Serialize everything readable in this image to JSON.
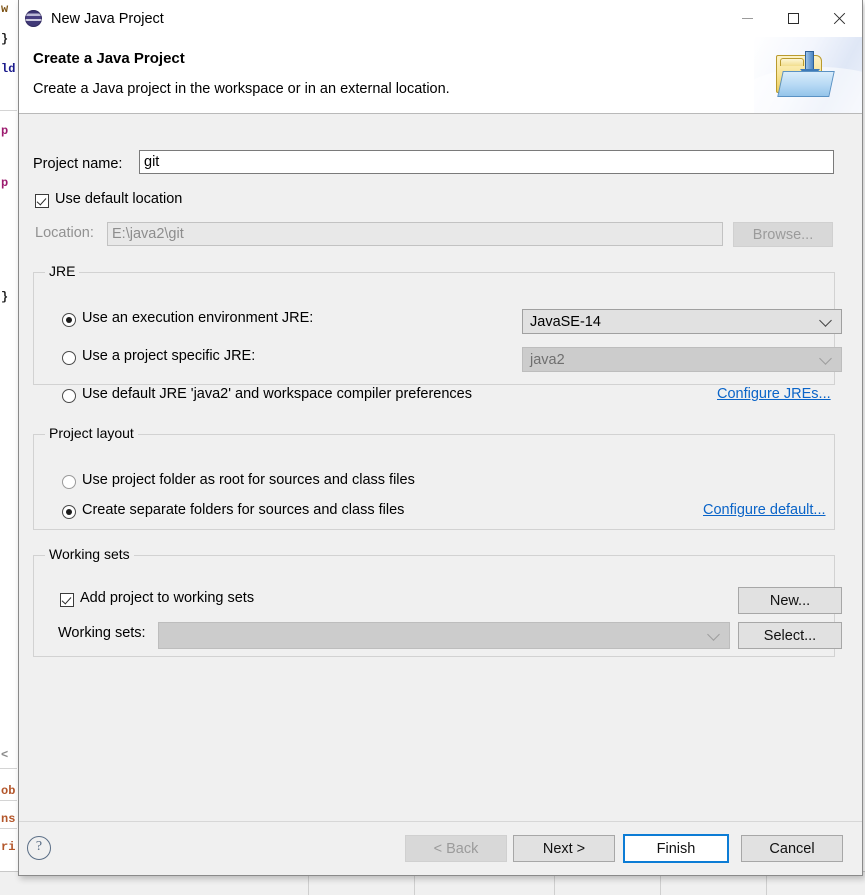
{
  "window": {
    "title": "New Java Project",
    "app_icon": "eclipse-sphere-icon",
    "minimize_label": "Minimize",
    "maximize_label": "Maximize",
    "close_label": "Close"
  },
  "header": {
    "title": "Create a Java Project",
    "description": "Create a Java project in the workspace or in an external location.",
    "banner_icon": "new-java-project-folder-icon"
  },
  "project": {
    "name_label": "Project name:",
    "name_value": "git",
    "name_placeholder": "",
    "use_default_location_label": "Use default location",
    "use_default_location_checked": true,
    "location_label": "Location:",
    "location_value": "E:\\java2\\git",
    "browse_label": "Browse...",
    "browse_enabled": false
  },
  "jre": {
    "group_title": "JRE",
    "option_execution_env": "Use an execution environment JRE:",
    "option_project_specific": "Use a project specific JRE:",
    "option_default_jre": "Use default JRE 'java2' and workspace compiler preferences",
    "selected": "execution_env",
    "execution_env_value": "JavaSE-14",
    "project_specific_value": "java2",
    "configure_link": "Configure JREs..."
  },
  "project_layout": {
    "group_title": "Project layout",
    "option_project_folder_root": "Use project folder as root for sources and class files",
    "option_separate_folders": "Create separate folders for sources and class files",
    "selected": "separate_folders",
    "configure_link": "Configure default..."
  },
  "working_sets": {
    "group_title": "Working sets",
    "add_checkbox_label": "Add project to working sets",
    "add_checkbox_checked": true,
    "new_button": "New...",
    "working_sets_label": "Working sets:",
    "working_sets_value": "",
    "select_button": "Select..."
  },
  "footer": {
    "help_icon": "help-question-icon",
    "back_label": "< Back",
    "back_enabled": false,
    "next_label": "Next >",
    "finish_label": "Finish",
    "cancel_label": "Cancel",
    "default_button": "Finish"
  },
  "backdrop": {
    "code_fragments": [
      "w",
      "}",
      "ld",
      "p",
      "p",
      "}",
      "<",
      "ob",
      "ns",
      "ri"
    ]
  },
  "colors": {
    "accent": "#0c7cd5",
    "link": "#0a64c8",
    "dialog_bg": "#f0f0f0",
    "header_bg": "#ffffff"
  }
}
